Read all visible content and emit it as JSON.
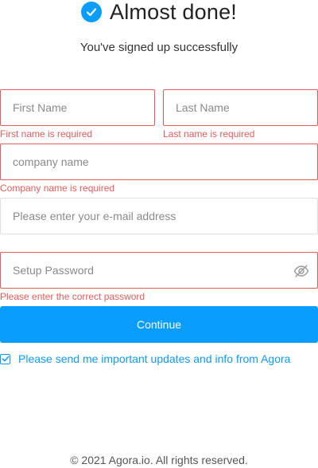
{
  "header": {
    "title": "Almost done!",
    "icon": "check-circle-icon",
    "accent_color": "#099dfd"
  },
  "subtitle": "You've signed up successfully",
  "form": {
    "first_name": {
      "placeholder": "First Name",
      "value": "",
      "error": "First name is required"
    },
    "last_name": {
      "placeholder": "Last Name",
      "value": "",
      "error": "Last name is required"
    },
    "company": {
      "placeholder": "company name",
      "value": "",
      "error": "Company name is required"
    },
    "email": {
      "placeholder": "Please enter your e-mail address",
      "value": ""
    },
    "password": {
      "placeholder": "Setup Password",
      "value": "",
      "error": "Please enter the correct password",
      "toggle_icon": "eye-hidden-icon"
    }
  },
  "continue_label": "Continue",
  "consent": {
    "checked": true,
    "label": "Please send me important updates and info from Agora"
  },
  "footer": "© 2021 Agora.io. All rights reserved.",
  "colors": {
    "primary": "#099dfd",
    "error": "#e85b5b"
  }
}
